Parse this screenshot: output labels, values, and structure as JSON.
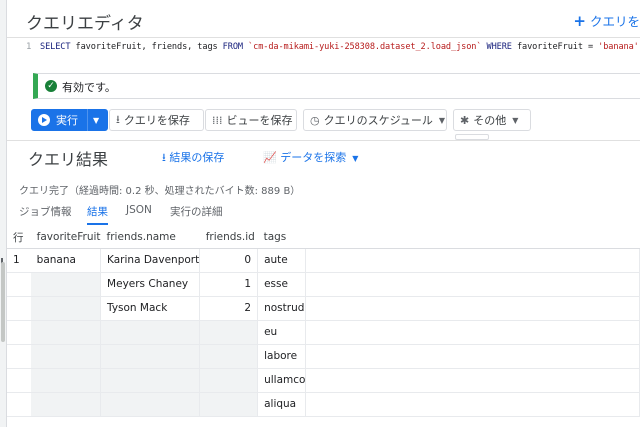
{
  "editor": {
    "title": "クエリエディタ",
    "new_query_label": "クエリを",
    "line_number": "1",
    "sql": {
      "select_kw": "SELECT",
      "columns": " favoriteFruit, friends, tags ",
      "from_kw": "FROM",
      "table": " `cm-da-mikami-yuki-258308.dataset_2.load_json` ",
      "where_kw": "WHERE",
      "condition": " favoriteFruit = ",
      "value": "'banana'"
    }
  },
  "validation": {
    "message": "有効です。",
    "status_color": "#34a853"
  },
  "toolbar": {
    "run_label": "実行",
    "save_query_label": "クエリを保存",
    "save_view_label": "ビューを保存",
    "schedule_label": "クエリのスケジュール",
    "more_label": "その他",
    "accent_color": "#1a73e8"
  },
  "results": {
    "title": "クエリ結果",
    "save_results_label": "結果の保存",
    "explore_data_label": "データを探索",
    "status": "クエリ完了（経過時間: 0.2 秒、処理されたバイト数: 889 B）",
    "tabs": [
      "ジョブ情報",
      "結果",
      "JSON",
      "実行の詳細"
    ],
    "active_tab": "結果",
    "columns": [
      "行",
      "favoriteFruit",
      "friends.name",
      "friends.id",
      "tags"
    ],
    "rows": [
      [
        "1",
        "banana",
        "Karina Davenport",
        "0",
        "aute"
      ],
      [
        "",
        "",
        "Meyers Chaney",
        "1",
        "esse"
      ],
      [
        "",
        "",
        "Tyson Mack",
        "2",
        "nostrud"
      ],
      [
        "",
        "",
        "",
        "",
        "eu"
      ],
      [
        "",
        "",
        "",
        "",
        "labore"
      ],
      [
        "",
        "",
        "",
        "",
        "ullamco"
      ],
      [
        "",
        "",
        "",
        "",
        "aliqua"
      ]
    ]
  }
}
